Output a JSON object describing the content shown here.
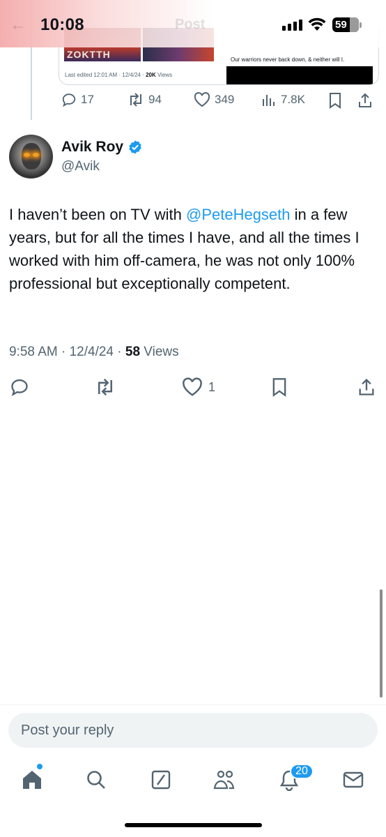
{
  "status_bar": {
    "time": "10:08",
    "battery": "59",
    "faded_title": "Post"
  },
  "parent_tweet": {
    "card_meta_prefix": "Last edited 12:01 AM · 12/4/24 · ",
    "card_views": "20K",
    "card_views_suffix": " Views",
    "card_image_text": "ZOKTTH",
    "card_quote": "Our warriors never back down, & neither will I.",
    "replies": "17",
    "reposts": "94",
    "likes": "349",
    "views": "7.8K"
  },
  "tweet": {
    "name": "Avik Roy",
    "handle": "@Avik",
    "text_before": "I haven’t been on TV with ",
    "mention": "@PeteHegseth",
    "text_after": " in a few years, but for all the times I have, and all the times I worked with him off-camera, he was not only 100% professional but exceptionally competent.",
    "timestamp": "9:58 AM · 12/4/24 · ",
    "views_count": "58",
    "views_label": " Views",
    "likes": "1"
  },
  "reply": {
    "placeholder": "Post your reply"
  },
  "tabbar": {
    "notifications_badge": "20"
  },
  "colors": {
    "accent": "#1d9bf0",
    "text": "#0f1419",
    "muted": "#536471"
  }
}
